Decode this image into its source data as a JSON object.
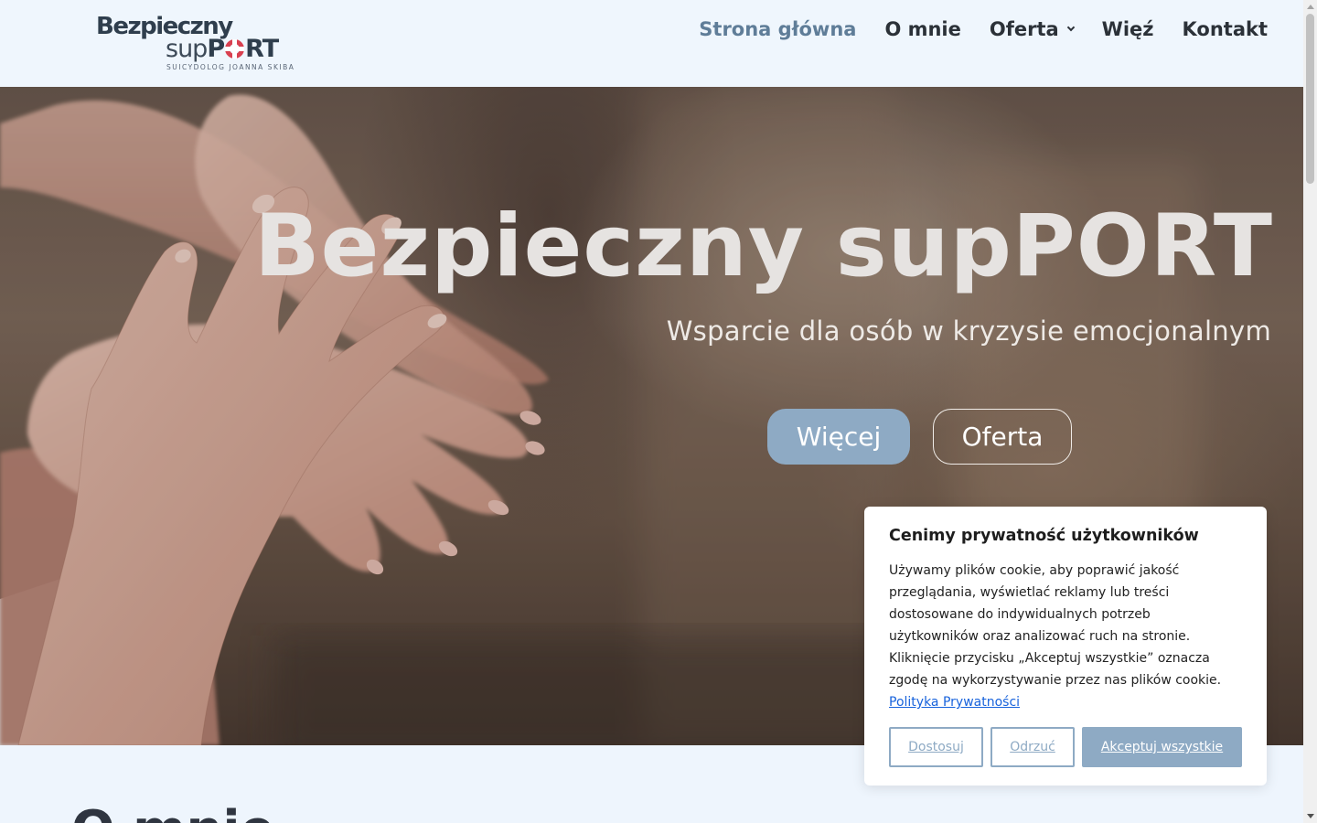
{
  "header": {
    "logo": {
      "line1": "Bezpieczny",
      "sup": "sup",
      "p": "P",
      "rt": "RT",
      "tagline": "SUICYDOLOG JOANNA SKIBA"
    },
    "nav": [
      {
        "label": "Strona główna",
        "active": true
      },
      {
        "label": "O mnie"
      },
      {
        "label": "Oferta",
        "has_dropdown": true
      },
      {
        "label": "Więź"
      },
      {
        "label": "Kontakt"
      }
    ]
  },
  "hero": {
    "title": "Bezpieczny supPORT",
    "subtitle": "Wsparcie dla osób w kryzysie emocjonalnym",
    "buttons": {
      "more": "Więcej",
      "offer": "Oferta"
    },
    "image": "hands-stacked-photo"
  },
  "next_section": {
    "heading_partial": "O mnie"
  },
  "cookie_banner": {
    "title": "Cenimy prywatność użytkowników",
    "body": "Używamy plików cookie, aby poprawić jakość przeglądania, wyświetlać reklamy lub treści dostosowane do indywidualnych potrzeb użytkowników oraz analizować ruch na stronie. Kliknięcie przycisku „Akceptuj wszystkie” oznacza zgodę na wykorzystywanie przez nas plików cookie.",
    "policy_link": "Polityka Prywatności",
    "buttons": {
      "customize": "Dostosuj",
      "reject": "Odrzuć",
      "accept_all": "Akceptuj wszystkie"
    }
  },
  "colors": {
    "accent": "#8eaac4",
    "nav_active": "#5f7d98",
    "link": "#1863dc",
    "header_bg": "#eff6fd",
    "logo_red": "#d94050"
  }
}
